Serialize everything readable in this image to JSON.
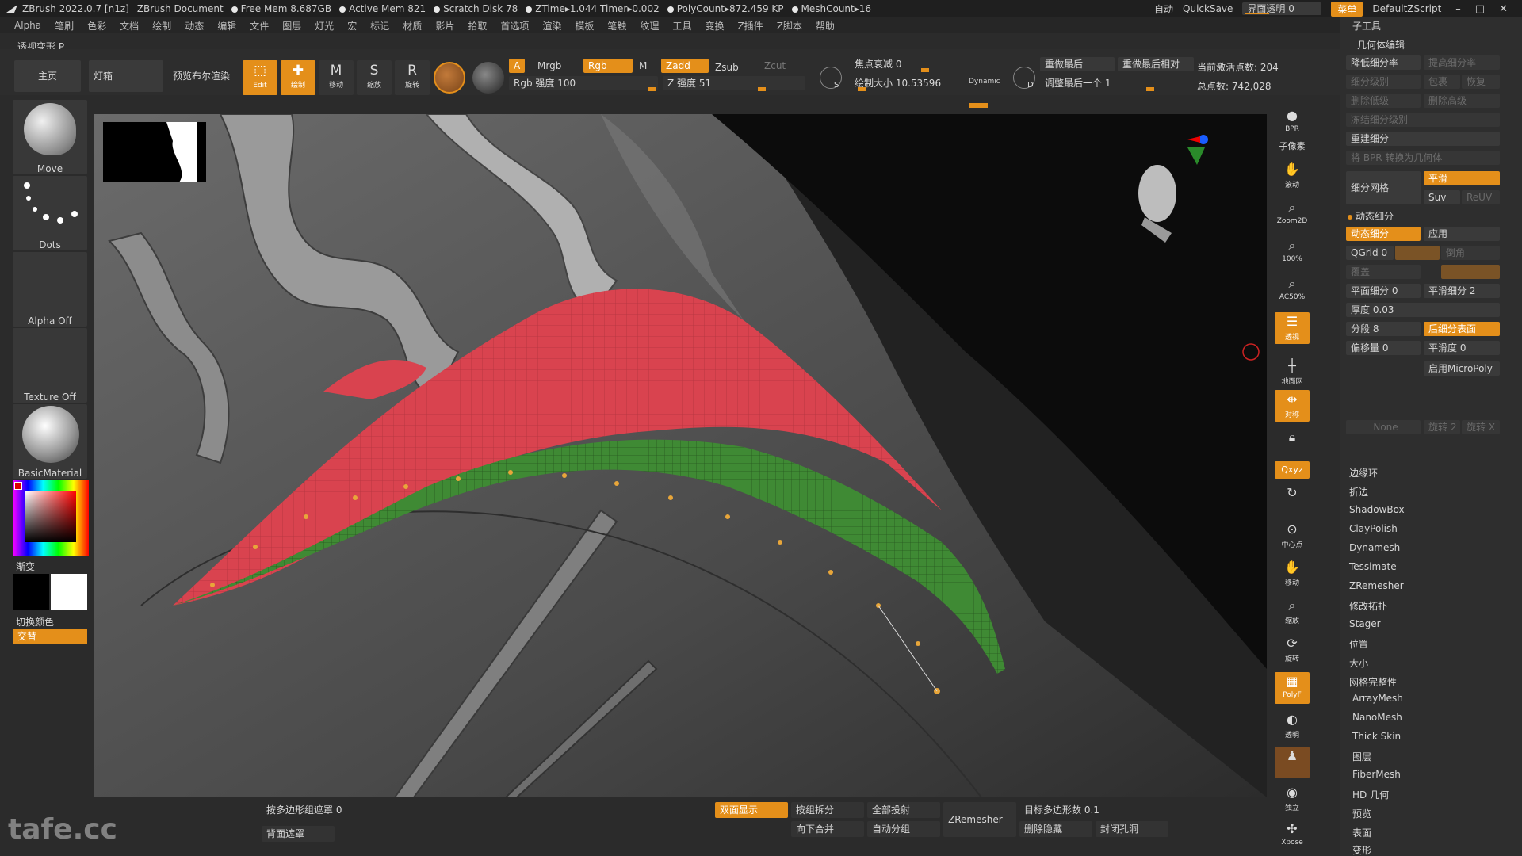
{
  "titlebar": {
    "app": "ZBrush 2022.0.7 [n1z]",
    "document": "ZBrush Document",
    "free_mem": "Free Mem 8.687GB",
    "active_mem": "Active Mem 821",
    "scratch": "Scratch Disk 78",
    "ztime": "ZTime▸1.044 Timer▸0.002",
    "polycount": "PolyCount▸872.459 KP",
    "meshcount": "MeshCount▸16",
    "auto": "自动",
    "quicksave": "QuickSave",
    "transparency": "界面透明 0",
    "menu": "菜单",
    "script": "DefaultZScript"
  },
  "menubar": [
    "Alpha",
    "笔刷",
    "色彩",
    "文档",
    "绘制",
    "动态",
    "编辑",
    "文件",
    "图层",
    "灯光",
    "宏",
    "标记",
    "材质",
    "影片",
    "拾取",
    "首选项",
    "渲染",
    "模板",
    "笔触",
    "纹理",
    "工具",
    "变换",
    "Z插件",
    "Z脚本",
    "帮助"
  ],
  "subtitle": "透视变形 P",
  "toolbar": {
    "home": "主页",
    "lightbox": "灯箱",
    "preview_bool": "预览布尔渲染",
    "edit": "Edit",
    "draw": "绘制",
    "move": "移动",
    "scale": "缩放",
    "rotate": "旋转",
    "a": "A",
    "mrgb": "Mrgb",
    "rgb": "Rgb",
    "m": "M",
    "rgb_intensity": "Rgb 强度 100",
    "zadd": "Zadd",
    "zsub": "Zsub",
    "zcut": "Zcut",
    "z_intensity": "Z 强度 51",
    "focal": "焦点衰减 0",
    "draw_size": "绘制大小 10.53596",
    "dynamic": "Dynamic",
    "replay_last": "重做最后",
    "replay_last_rel": "重做最后相对",
    "adjust_last": "调整最后一个 1",
    "active_points": "当前激活点数: 204",
    "total_points": "总点数: 742,028",
    "s_label": "S",
    "d_label": "D"
  },
  "left": {
    "brush": "Move",
    "stroke": "Dots",
    "alpha": "Alpha Off",
    "texture": "Texture Off",
    "material": "BasicMaterial",
    "gradient": "渐变",
    "switch_color": "切换颜色",
    "alternate": "交替"
  },
  "rightstrip": {
    "bpr": "BPR",
    "subpixel": "子像素",
    "scroll": "滚动",
    "zoom2d": "Zoom2D",
    "pct100": "100%",
    "ac50": "AC50%",
    "persp": "透视",
    "floor": "地面网",
    "local": "对称",
    "xyz": "Qxyz",
    "center": "中心点",
    "move": "移动",
    "zoom": "缩放",
    "rotate": "旋转",
    "polyf": "PolyF",
    "transp": "透明",
    "solo": "独立",
    "xpose": "Xpose"
  },
  "rpanel": {
    "subtool": "子工具",
    "geometry": "几何体编辑",
    "lower_res": "降低细分率",
    "higher_res": "提高细分率",
    "sdiv": "细分级别",
    "cage": "包裹",
    "restore": "恢复",
    "del_lower": "删除低级",
    "del_higher": "删除高级",
    "freeze": "冻结细分级别",
    "reconstruct": "重建细分",
    "bpr_to_geo": "将 BPR 转换为几何体",
    "divide": "细分网格",
    "smooth": "平滑",
    "suv": "Suv",
    "reuv": "ReUV",
    "dynamic_sub": "动态细分",
    "dynamic_sub_btn": "动态细分",
    "apply": "应用",
    "qgrid": "QGrid 0",
    "coverage": "覆盖",
    "chamfer": "倒角",
    "flat_sub": "平面细分 0",
    "smooth_sub": "平滑细分 2",
    "thickness": "厚度 0.03",
    "segments": "分段 8",
    "post_sub": "后细分表面",
    "offset": "偏移量 0",
    "smoothness": "平滑度 0",
    "micropoly": "启用MicroPoly",
    "none": "None",
    "rotate2": "旋转 2",
    "rotate_x": "旋转 X",
    "edge_loop": "边缘环",
    "crease": "折边",
    "shadowbox": "ShadowBox",
    "claypolish": "ClayPolish",
    "dynamesh": "Dynamesh",
    "tessimate": "Tessimate",
    "zremesher": "ZRemesher",
    "modify_topo": "修改拓扑",
    "stager": "Stager",
    "position": "位置",
    "size": "大小",
    "mesh_integrity": "网格完整性",
    "arraymesh": "ArrayMesh",
    "nanomesh": "NanoMesh",
    "thickskin": "Thick Skin",
    "layers": "图层",
    "fibermesh": "FiberMesh",
    "hd_geo": "HD 几何",
    "preview": "预览",
    "surface": "表面",
    "deform": "变形"
  },
  "bottom": {
    "by_polygroup_mask": "按多边形组遮罩 0",
    "backface_mask": "背面遮罩",
    "double_sided": "双面显示",
    "split_by_group": "按组拆分",
    "merge_down": "向下合并",
    "project_all": "全部投射",
    "auto_group": "自动分组",
    "zremesher": "ZRemesher",
    "target_poly": "目标多边形数 0.1",
    "del_hidden": "删除隐藏",
    "close_holes": "封闭孔洞"
  },
  "watermark": "tafe.cc",
  "colors": {
    "accent": "#e48f1a",
    "red_mesh": "#d9434f",
    "green_mesh": "#3f8a34"
  }
}
